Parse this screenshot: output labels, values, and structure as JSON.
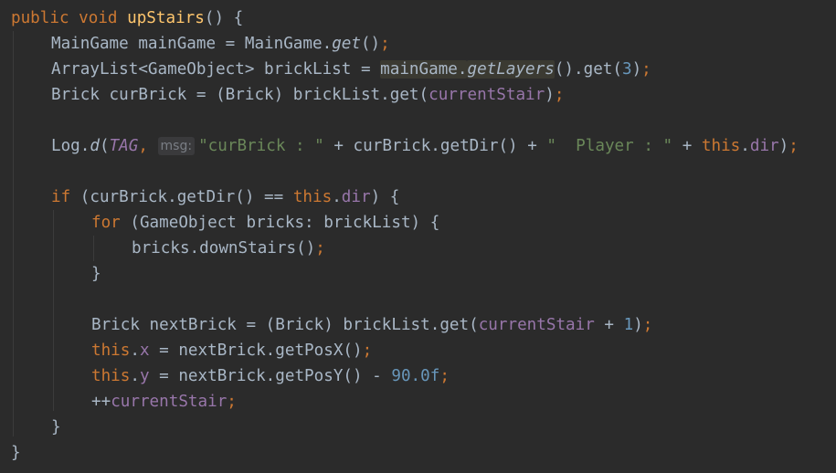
{
  "editor": {
    "language": "Java",
    "lines": [
      {
        "indent": 0,
        "tokens": [
          {
            "t": "public",
            "c": "kw"
          },
          {
            "t": " "
          },
          {
            "t": "void",
            "c": "kw"
          },
          {
            "t": " "
          },
          {
            "t": "upStairs",
            "c": "fn"
          },
          {
            "t": "() {"
          }
        ]
      },
      {
        "indent": 1,
        "tokens": [
          {
            "t": "MainGame mainGame = MainGame."
          },
          {
            "t": "get",
            "c": "it"
          },
          {
            "t": "()"
          },
          {
            "t": ";",
            "c": "semi"
          }
        ]
      },
      {
        "indent": 1,
        "tokens": [
          {
            "t": "ArrayList<GameObject> brickList = "
          },
          {
            "t": "mainGame.",
            "c": "hl"
          },
          {
            "t": "getLayers",
            "c": "hl it"
          },
          {
            "t": "().get("
          },
          {
            "t": "3",
            "c": "num"
          },
          {
            "t": ")"
          },
          {
            "t": ";",
            "c": "semi"
          }
        ]
      },
      {
        "indent": 1,
        "tokens": [
          {
            "t": "Brick curBrick = (Brick) brickList.get("
          },
          {
            "t": "currentStair",
            "c": "fld"
          },
          {
            "t": ")"
          },
          {
            "t": ";",
            "c": "semi"
          }
        ]
      },
      {
        "indent": 0,
        "tokens": []
      },
      {
        "indent": 1,
        "tokens": [
          {
            "t": "Log."
          },
          {
            "t": "d",
            "c": "it"
          },
          {
            "t": "("
          },
          {
            "t": "TAG",
            "c": "fld it"
          },
          {
            "t": ", ",
            "c": "semi"
          },
          {
            "t": "msg:",
            "c": "hint"
          },
          {
            "t": "\"curBrick : \"",
            "c": "str"
          },
          {
            "t": " + curBrick.getDir() + "
          },
          {
            "t": "\"  Player : \"",
            "c": "str"
          },
          {
            "t": " + "
          },
          {
            "t": "this",
            "c": "kw"
          },
          {
            "t": "."
          },
          {
            "t": "dir",
            "c": "fld"
          },
          {
            "t": ")"
          },
          {
            "t": ";",
            "c": "semi"
          }
        ]
      },
      {
        "indent": 0,
        "tokens": []
      },
      {
        "indent": 1,
        "tokens": [
          {
            "t": "if",
            "c": "kw"
          },
          {
            "t": " (curBrick.getDir() == "
          },
          {
            "t": "this",
            "c": "kw"
          },
          {
            "t": "."
          },
          {
            "t": "dir",
            "c": "fld"
          },
          {
            "t": ") {"
          }
        ]
      },
      {
        "indent": 2,
        "tokens": [
          {
            "t": "for",
            "c": "kw"
          },
          {
            "t": " (GameObject bricks: brickList) {"
          }
        ]
      },
      {
        "indent": 3,
        "tokens": [
          {
            "t": "bricks.downStairs()"
          },
          {
            "t": ";",
            "c": "semi"
          }
        ]
      },
      {
        "indent": 2,
        "tokens": [
          {
            "t": "}"
          }
        ]
      },
      {
        "indent": 0,
        "tokens": []
      },
      {
        "indent": 2,
        "tokens": [
          {
            "t": "Brick nextBrick = (Brick) brickList.get("
          },
          {
            "t": "currentStair",
            "c": "fld"
          },
          {
            "t": " + "
          },
          {
            "t": "1",
            "c": "num"
          },
          {
            "t": ")"
          },
          {
            "t": ";",
            "c": "semi"
          }
        ]
      },
      {
        "indent": 2,
        "tokens": [
          {
            "t": "this",
            "c": "kw"
          },
          {
            "t": "."
          },
          {
            "t": "x",
            "c": "fld"
          },
          {
            "t": " = nextBrick.getPosX()"
          },
          {
            "t": ";",
            "c": "semi"
          }
        ]
      },
      {
        "indent": 2,
        "tokens": [
          {
            "t": "this",
            "c": "kw"
          },
          {
            "t": "."
          },
          {
            "t": "y",
            "c": "fld"
          },
          {
            "t": " = nextBrick.getPosY() - "
          },
          {
            "t": "90.0f",
            "c": "num"
          },
          {
            "t": ";",
            "c": "semi"
          }
        ]
      },
      {
        "indent": 2,
        "tokens": [
          {
            "t": "++"
          },
          {
            "t": "currentStair",
            "c": "fld"
          },
          {
            "t": ";",
            "c": "semi"
          }
        ]
      },
      {
        "indent": 1,
        "tokens": [
          {
            "t": "}"
          }
        ]
      },
      {
        "indent": 0,
        "tokens": [
          {
            "t": "}"
          }
        ]
      }
    ]
  }
}
